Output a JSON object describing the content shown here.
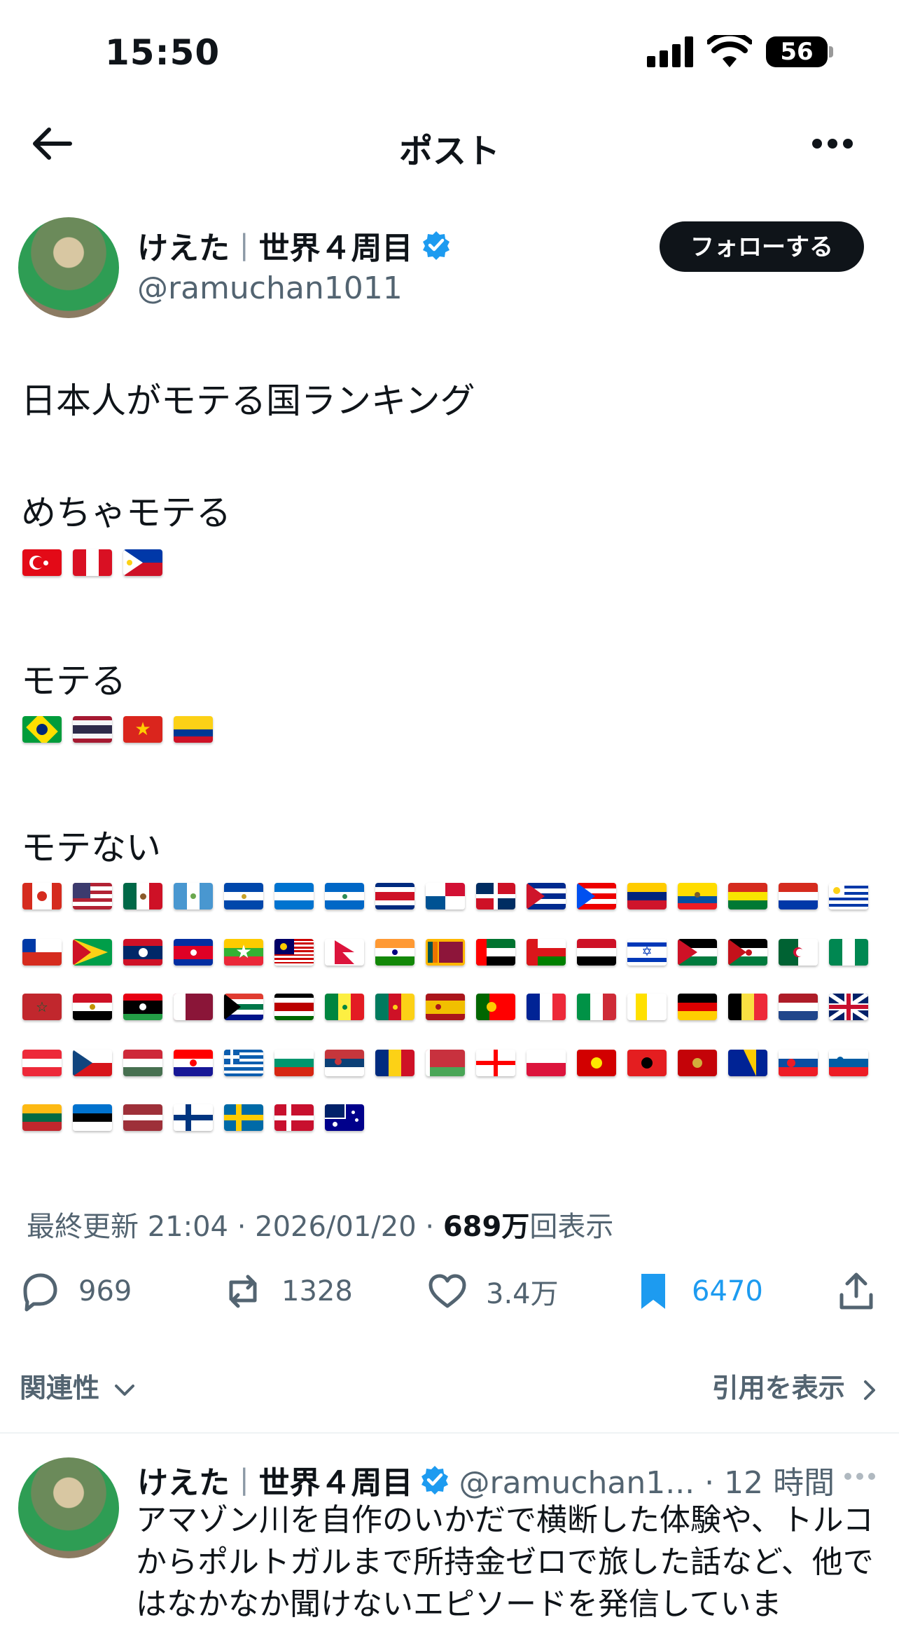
{
  "status_bar": {
    "time": "15:50",
    "battery": "56"
  },
  "header": {
    "title": "ポスト",
    "back_icon": "arrow-left-icon",
    "more_icon": "more-horizontal-icon"
  },
  "author": {
    "name": "けえた",
    "name_suffix": "世界４周目",
    "handle": "@ramuchan1011",
    "follow_label": "フォローする",
    "verified_color": "#1d9bf0"
  },
  "post": {
    "title": "日本人がモテる国ランキング",
    "sections": [
      {
        "label": "めちゃモテる",
        "flags": [
          "turkey",
          "peru",
          "philippines"
        ]
      },
      {
        "label": "モテる",
        "flags": [
          "brazil",
          "thailand",
          "vietnam",
          "colombia"
        ]
      },
      {
        "label": "モテない",
        "flags": [
          "canada",
          "usa",
          "mexico",
          "guatemala",
          "el-salvador",
          "honduras",
          "nicaragua",
          "costa-rica",
          "panama",
          "dominican-republic",
          "cuba",
          "puerto-rico",
          "venezuela",
          "ecuador",
          "bolivia",
          "paraguay",
          "uruguay",
          "chile",
          "guyana",
          "laos",
          "cambodia",
          "myanmar",
          "malaysia",
          "nepal",
          "india",
          "sri-lanka",
          "uae",
          "oman",
          "yemen",
          "israel",
          "jordan",
          "western-sahara",
          "algeria",
          "nigeria",
          "morocco",
          "egypt",
          "libya",
          "qatar",
          "south-africa",
          "kenya",
          "senegal",
          "cameroon",
          "spain",
          "portugal",
          "france",
          "italy",
          "vatican",
          "germany",
          "belgium",
          "netherlands",
          "uk",
          "austria",
          "czechia",
          "hungary",
          "croatia",
          "greece",
          "bulgaria",
          "serbia",
          "romania",
          "belarus",
          "georgia",
          "poland",
          "north-macedonia",
          "albania",
          "montenegro",
          "bosnia",
          "slovakia",
          "slovenia",
          "lithuania",
          "estonia",
          "latvia",
          "finland",
          "sweden",
          "denmark",
          "australia"
        ]
      }
    ]
  },
  "meta": {
    "updated": "最終更新 21:04 · 2026/01/20",
    "views_number": "689万",
    "views_label": "回表示"
  },
  "actions": {
    "replies": "969",
    "reposts": "1328",
    "likes": "3.4万",
    "bookmarks": "6470",
    "bookmark_color": "#1d9bf0"
  },
  "sort": {
    "relevance": "関連性",
    "quotes": "引用を表示"
  },
  "reply": {
    "name": "けえた",
    "name_suffix": "世界４周目",
    "handle_time": "@ramuchan1... · 12 時間",
    "text": "アマゾン川を自作のいかだで横断した体験や、トルコからポルトガルまで所持金ゼロで旅した話など、他ではなかなか聞けないエピソードを発信していま"
  }
}
